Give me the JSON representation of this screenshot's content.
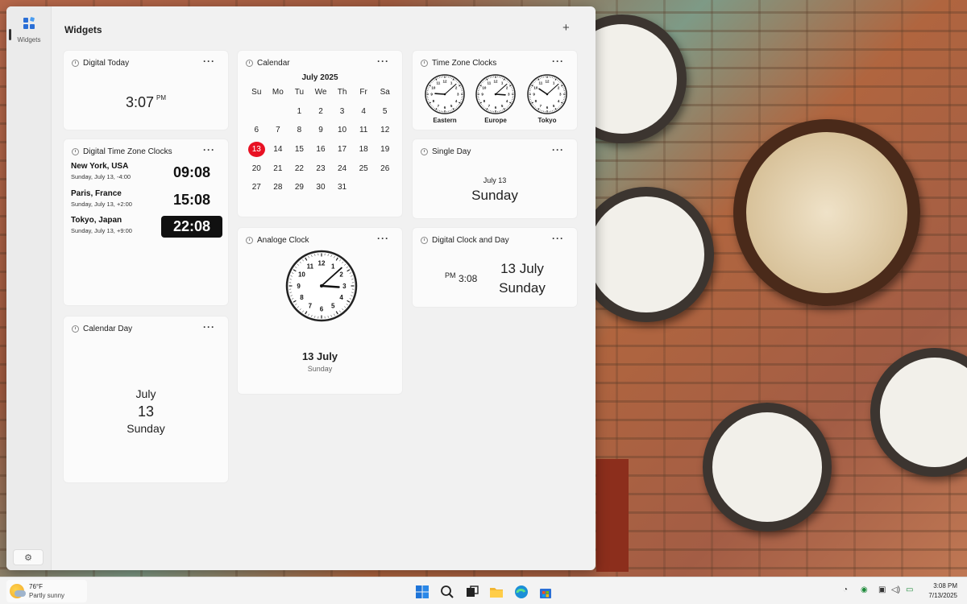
{
  "sidebar": {
    "widgets_label": "Widgets"
  },
  "panel": {
    "title": "Widgets",
    "add_label": "+"
  },
  "more_label": "···",
  "digital_today": {
    "title": "Digital Today",
    "time": "3:07",
    "ampm": "PM"
  },
  "tz_list": {
    "title": "Digital Time Zone Clocks",
    "rows": [
      {
        "city": "New York, USA",
        "date": "Sunday, July 13, -4:00",
        "time": "09:08"
      },
      {
        "city": "Paris, France",
        "date": "Sunday, July 13, +2:00",
        "time": "15:08"
      },
      {
        "city": "Tokyo, Japan",
        "date": "Sunday, July 13, +9:00",
        "time": "22:08"
      }
    ]
  },
  "calendar": {
    "title": "Calendar",
    "month": "July 2025",
    "weekdays": [
      "Su",
      "Mo",
      "Tu",
      "We",
      "Th",
      "Fr",
      "Sa"
    ],
    "first_weekday_index": 2,
    "days_in_month": 31,
    "today": 13,
    "today_color": "#e81123"
  },
  "tz_clocks": {
    "title": "Time Zone Clocks",
    "clocks": [
      {
        "label": "Eastern",
        "hour": 9,
        "minute": 8
      },
      {
        "label": "Europe",
        "hour": 15,
        "minute": 8
      },
      {
        "label": "Tokyo",
        "hour": 22,
        "minute": 8
      }
    ]
  },
  "single_day": {
    "title": "Single Day",
    "date": "July 13",
    "day": "Sunday"
  },
  "analog": {
    "title": "Analoge Clock",
    "hour": 3,
    "minute": 8,
    "date": "13 July",
    "day": "Sunday"
  },
  "clock_and_day": {
    "title": "Digital Clock and Day",
    "ampm": "PM",
    "time": "3:08",
    "date": "13 July",
    "day": "Sunday"
  },
  "calendar_day": {
    "title": "Calendar Day",
    "month": "July",
    "day_num": "13",
    "weekday": "Sunday"
  },
  "taskbar": {
    "temp": "76°F",
    "condition": "Partly sunny",
    "time": "3:08 PM",
    "date": "7/13/2025"
  }
}
